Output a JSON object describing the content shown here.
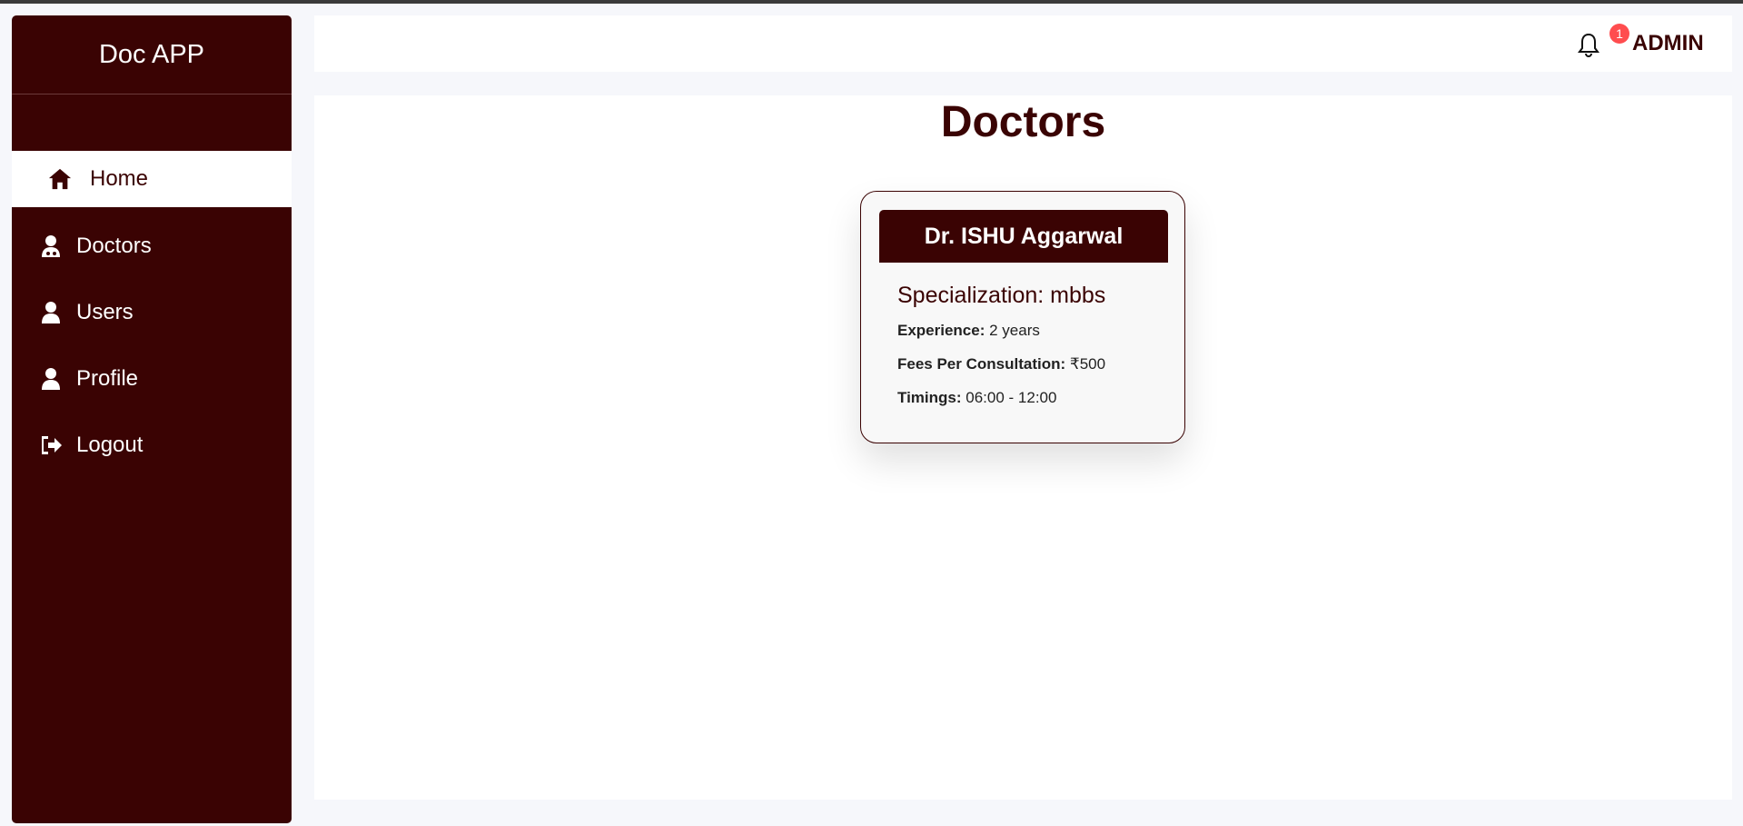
{
  "app": {
    "title": "Doc APP"
  },
  "sidebar": {
    "items": [
      {
        "label": "Home",
        "icon": "home-icon",
        "active": true
      },
      {
        "label": "Doctors",
        "icon": "doctor-icon",
        "active": false
      },
      {
        "label": "Users",
        "icon": "user-icon",
        "active": false
      },
      {
        "label": "Profile",
        "icon": "user-icon",
        "active": false
      },
      {
        "label": "Logout",
        "icon": "logout-icon",
        "active": false
      }
    ]
  },
  "header": {
    "notification_count": "1",
    "user_label": "ADMIN"
  },
  "main": {
    "title": "Doctors",
    "doctor_card": {
      "name": "Dr. ISHU Aggarwal",
      "specialization": "Specialization: mbbs",
      "experience_label": "Experience:",
      "experience_value": "2 years",
      "fees_label": "Fees Per Consultation:",
      "fees_value": "₹500",
      "timings_label": "Timings:",
      "timings_value": "06:00 - 12:00"
    }
  },
  "colors": {
    "primary": "#3a0303",
    "badge": "#ff4d4f",
    "background": "#f6f7fb"
  }
}
